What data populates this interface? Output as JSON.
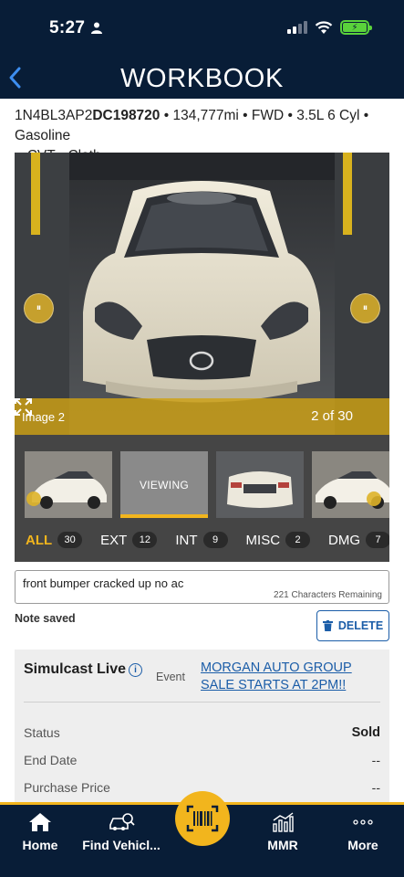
{
  "status_bar": {
    "time": "5:27"
  },
  "header": {
    "title": "WORKBOOK"
  },
  "vehicle": {
    "vin_prefix": "1N4BL3AP2",
    "vin_suffix": "DC198720",
    "details_line1": " • 134,777mi • FWD • 3.5L 6 Cyl • Gasoline",
    "details_line2": "• CVT • Cloth"
  },
  "gallery": {
    "current_label": "Image 2",
    "counter": "2 of 30",
    "viewing_label": "VIEWING",
    "filters": [
      {
        "label": "ALL",
        "count": "30"
      },
      {
        "label": "EXT",
        "count": "12"
      },
      {
        "label": "INT",
        "count": "9"
      },
      {
        "label": "MISC",
        "count": "2"
      },
      {
        "label": "DMG",
        "count": "7"
      }
    ]
  },
  "note": {
    "text": "front bumper cracked up no ac",
    "remaining": "221 Characters Remaining",
    "saved_label": "Note saved",
    "delete_label": "DELETE"
  },
  "simulcast": {
    "title": "Simulcast Live",
    "event_label": "Event",
    "event_link": "MORGAN AUTO GROUP SALE STARTS AT 2PM!!",
    "rows": [
      {
        "label": "Status",
        "value": "Sold"
      },
      {
        "label": "End Date",
        "value": "--"
      },
      {
        "label": "Purchase Price",
        "value": "--"
      }
    ]
  },
  "bottom_nav": {
    "home": "Home",
    "find": "Find Vehicl...",
    "mmr": "MMR",
    "more": "More"
  },
  "colors": {
    "navy": "#081d37",
    "gold": "#f2b51d",
    "link_blue": "#1b5da8"
  }
}
